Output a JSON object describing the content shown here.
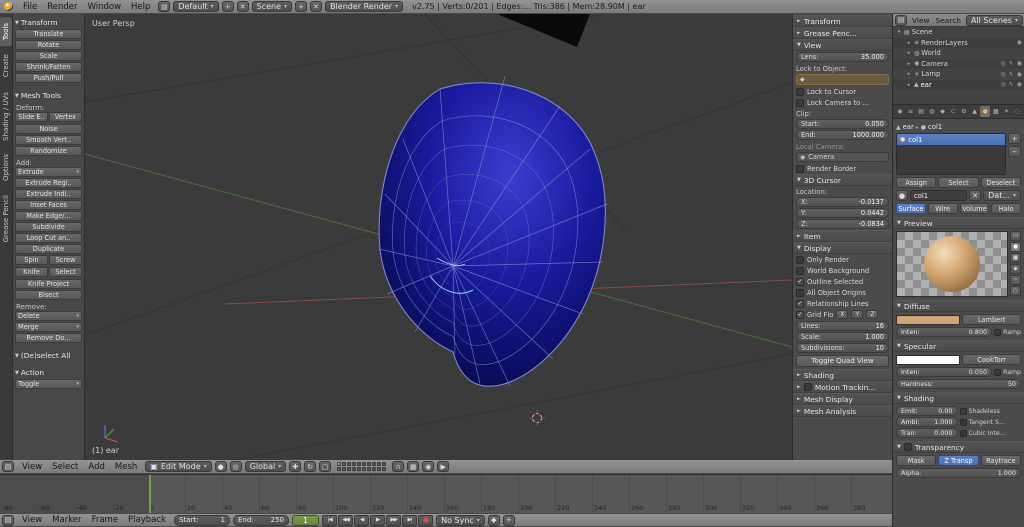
{
  "top_header": {
    "menus": [
      "File",
      "Render",
      "Window",
      "Help"
    ],
    "layout_dropdown": "Default",
    "scene_dropdown": "Scene",
    "engine_dropdown": "Blender Render",
    "stats": "v2.75 | Verts:0/201 | Edges:... Tris:386 | Mem:28.90M | ear"
  },
  "tool_tabs": [
    "Tools",
    "Create",
    "Shading / UVs",
    "Options",
    "Grease Pencil"
  ],
  "tool_shelf": {
    "transform": {
      "title": "Transform",
      "buttons": [
        "Translate",
        "Rotate",
        "Scale",
        "Shrink/Fatten",
        "Push/Pull"
      ]
    },
    "mesh_tools": {
      "title": "Mesh Tools",
      "deform_label": "Deform:",
      "deform_row": [
        "Slide E..",
        "Vertex"
      ],
      "deform_buttons": [
        "Noise",
        "Smooth Vert..",
        "Randomize"
      ],
      "add_label": "Add:",
      "add_buttons": [
        "Extrude",
        "Extrude Regi..",
        "Extrude Indi..",
        "Inset Faces",
        "Make Edge/...",
        "Subdivide",
        "Loop Cut an..",
        "Duplicate"
      ],
      "add_rows": [
        [
          "Spin",
          "Screw"
        ],
        [
          "Knife",
          "Select"
        ]
      ],
      "add_buttons2": [
        "Knife Project",
        "Bisect"
      ],
      "remove_label": "Remove:",
      "remove_buttons": [
        "Delete",
        "Merge",
        "Remove Do..."
      ]
    },
    "deselect": {
      "title": "(De)select All"
    },
    "action": {
      "title": "Action",
      "toggle": "Toggle"
    }
  },
  "viewport": {
    "view_label": "User Persp",
    "object_label": "(1) ear"
  },
  "n_panel": {
    "transform_header": "Transform",
    "grease_header": "Grease Penc...",
    "view_header": "View",
    "lens": {
      "label": "Lens:",
      "value": "35.000"
    },
    "lock_to_object": "Lock to Object:",
    "lock_to_cursor": "Lock to Cursor",
    "lock_camera": "Lock Camera to ...",
    "clip_label": "Clip:",
    "clip_start": {
      "label": "Start:",
      "value": "0.050"
    },
    "clip_end": {
      "label": "End:",
      "value": "1000.000"
    },
    "local_camera_label": "Local Camera:",
    "local_camera_value": "Camera",
    "render_border": "Render Border",
    "cursor_header": "3D Cursor",
    "location_label": "Location:",
    "cursor_x": {
      "label": "X:",
      "value": "-0.0137"
    },
    "cursor_y": {
      "label": "Y:",
      "value": "0.0442"
    },
    "cursor_z": {
      "label": "Z:",
      "value": "-0.0834"
    },
    "item_header": "Item",
    "display_header": "Display",
    "display_checks": [
      {
        "label": "Only Render",
        "checked": false
      },
      {
        "label": "World Background",
        "checked": false
      },
      {
        "label": "Outline Selected",
        "checked": true
      },
      {
        "label": "All Object Origins",
        "checked": false
      },
      {
        "label": "Relationship Lines",
        "checked": true
      }
    ],
    "grid_floor": {
      "label": "Grid Flo",
      "checked": true,
      "axes": [
        "X",
        "Y",
        "Z"
      ]
    },
    "lines": {
      "label": "Lines:",
      "value": "16"
    },
    "scale": {
      "label": "Scale:",
      "value": "1.000"
    },
    "subdivisions": {
      "label": "Subdivisions:",
      "value": "10"
    },
    "quad_view_button": "Toggle Quad View",
    "shading_header": "Shading",
    "motion_header": "Motion Trackin...",
    "mesh_display_header": "Mesh Display",
    "mesh_analysis_header": "Mesh Analysis"
  },
  "outliner": {
    "menus": [
      "View",
      "Search"
    ],
    "display_mode": "All Scenes",
    "items": [
      {
        "label": "Scene",
        "icon": "scene",
        "expanded": true,
        "right_icons": [],
        "active": false
      },
      {
        "label": "RenderLayers",
        "icon": "render-layers",
        "expanded": false,
        "right_icons": [
          "renderable"
        ],
        "active": false
      },
      {
        "label": "World",
        "icon": "world",
        "expanded": false,
        "right_icons": [],
        "active": false
      },
      {
        "label": "Camera",
        "icon": "camera",
        "expanded": false,
        "right_icons": [
          "eye",
          "cursor",
          "renderable"
        ],
        "active": false
      },
      {
        "label": "Lamp",
        "icon": "lamp",
        "expanded": false,
        "right_icons": [
          "eye",
          "cursor",
          "renderable"
        ],
        "active": false
      },
      {
        "label": "ear",
        "icon": "mesh",
        "expanded": false,
        "right_icons": [
          "eye",
          "cursor",
          "renderable"
        ],
        "active": true
      }
    ]
  },
  "properties": {
    "tabs": [
      "render",
      "render-layers",
      "scene",
      "world",
      "object",
      "constraints",
      "modifiers",
      "object-data",
      "material",
      "texture",
      "particles",
      "physics"
    ],
    "active_tab": "material",
    "breadcrumb": {
      "object": "ear",
      "material": "col1"
    },
    "slot_name": "col1",
    "assign_button": "Assign",
    "select_button": "Select",
    "deselect_button": "Deselect",
    "name_value": "col1",
    "data_button": "Dat...",
    "surface_types": [
      {
        "label": "Surface",
        "active": true
      },
      {
        "label": "Wire",
        "active": false
      },
      {
        "label": "Volume",
        "active": false
      },
      {
        "label": "Halo",
        "active": false
      }
    ],
    "preview_header": "Preview",
    "diffuse_header": "Diffuse",
    "diffuse_shader": "Lambert",
    "diffuse_intensity_label": "Inten:",
    "diffuse_intensity_value": "0.800",
    "diffuse_ramp": "Ramp",
    "specular_header": "Specular",
    "specular_shader": "CookTorr",
    "specular_intensity_label": "Inten:",
    "specular_intensity_value": "0.050",
    "specular_ramp": "Ramp",
    "hardness_label": "Hardness:",
    "hardness_value": "50",
    "shading_header": "Shading",
    "shading_fields": [
      {
        "label": "Emit:",
        "value": "0.00"
      },
      {
        "label": "Ambi:",
        "value": "1.000"
      },
      {
        "label": "Tran:",
        "value": "0.000"
      }
    ],
    "shading_checks": [
      "Shadeless",
      "Tangent S...",
      "Cubic Inte..."
    ],
    "transparency_header": "Transparency",
    "transparency_modes": [
      {
        "label": "Mask",
        "active": false
      },
      {
        "label": "Z Transp",
        "active": true
      },
      {
        "label": "Raytrace",
        "active": false
      }
    ],
    "alpha_label": "Alpha:",
    "alpha_value": "1.000"
  },
  "viewport_header": {
    "menus": [
      "View",
      "Select",
      "Add",
      "Mesh"
    ],
    "mode": "Edit Mode",
    "orientation": "Global"
  },
  "timeline": {
    "menus": [
      "View",
      "Marker",
      "Frame",
      "Playback"
    ],
    "start_label": "Start:",
    "start_value": "1",
    "end_label": "End:",
    "end_value": "250",
    "current_frame": "1",
    "sync": "No Sync",
    "ruler_labels": [
      "-80",
      "-60",
      "-40",
      "-20",
      "0",
      "20",
      "40",
      "60",
      "80",
      "100",
      "120",
      "140",
      "160",
      "180",
      "200",
      "220",
      "240",
      "260",
      "280",
      "300",
      "320",
      "340",
      "360",
      "380"
    ]
  },
  "colors": {
    "accent": "#5680c4",
    "diffuse_swatch": "#cfa675",
    "specular_swatch": "#ffffff",
    "mesh_fill": "#1a1ca0",
    "frame_line_green": "#69a84f"
  }
}
